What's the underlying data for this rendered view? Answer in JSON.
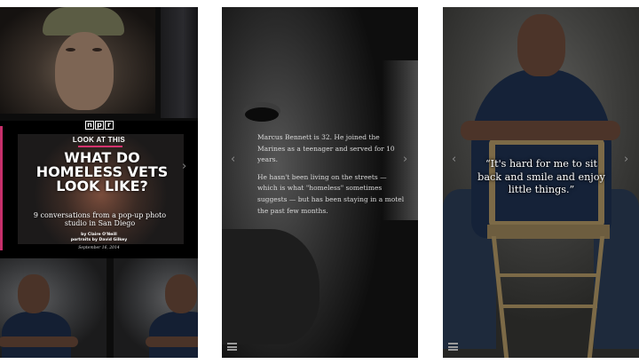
{
  "screen1": {
    "logo": {
      "letters": [
        "n",
        "p",
        "r"
      ]
    },
    "kicker": "LOOK AT THIS",
    "headline": "WHAT DO HOMELESS VETS LOOK LIKE?",
    "dek": "9 conversations from a pop-up photo studio in San Diego",
    "byline_author": "by Claire O'Neill",
    "byline_portraits": "portraits by David Gilkey",
    "date": "September 16, 2014",
    "next_arrow": "›",
    "accent_color": "#d6336f"
  },
  "screen2": {
    "prev_arrow": "‹",
    "next_arrow": "›",
    "paragraphs": [
      "Marcus Bennett is 32. He joined the Marines as a teenager and served for 10 years.",
      "He hasn't been living on the streets — which is what \"homeless\" sometimes suggests — but has been staying in a motel the past few months."
    ],
    "menu_icon": "hamburger-menu-icon"
  },
  "screen3": {
    "prev_arrow": "‹",
    "next_arrow": "›",
    "quote": "“It's hard for me to sit back and smile and enjoy little things.”",
    "menu_icon": "hamburger-menu-icon"
  }
}
